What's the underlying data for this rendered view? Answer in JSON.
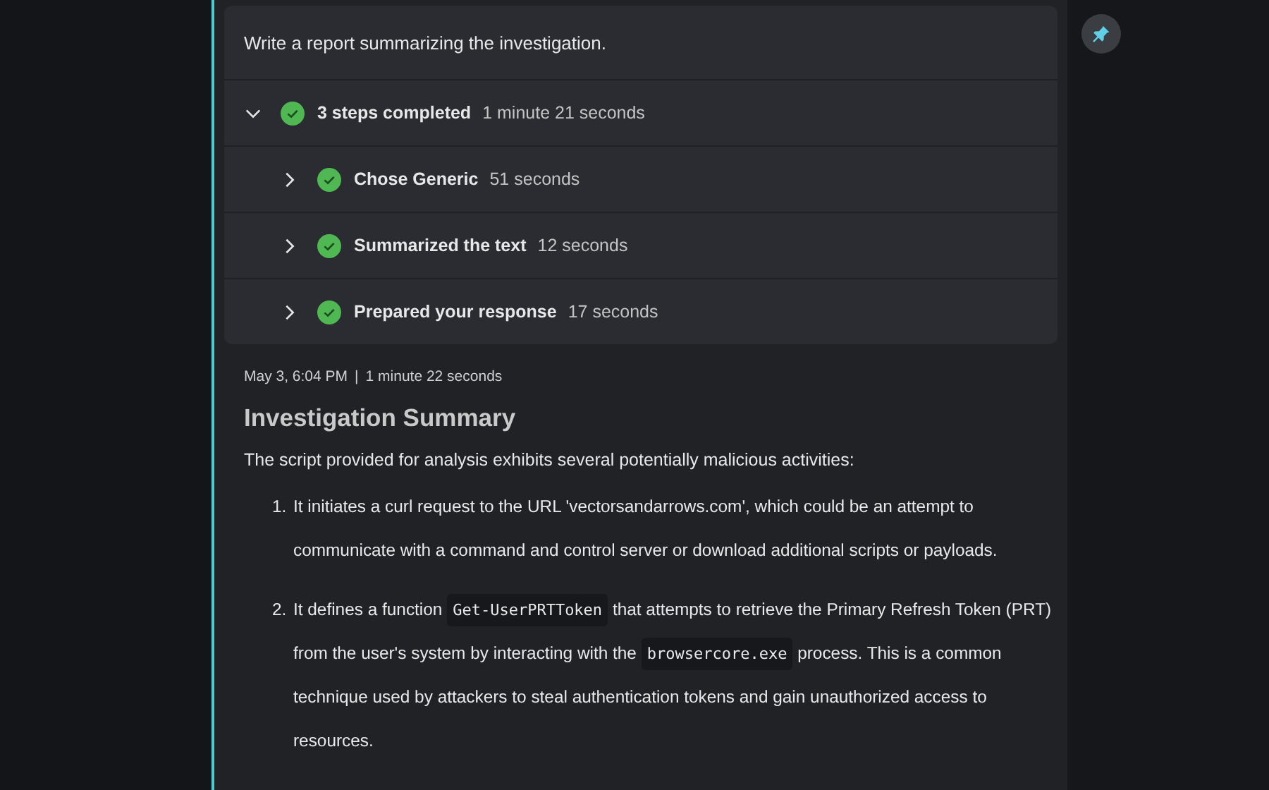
{
  "prompt": "Write a report summarizing the investigation.",
  "steps": {
    "label": "3 steps completed",
    "duration": "1 minute 21 seconds",
    "expanded": true,
    "completed": true,
    "children": [
      {
        "label": "Chose Generic",
        "duration": "51 seconds",
        "expanded": false,
        "completed": true
      },
      {
        "label": "Summarized the text",
        "duration": "12 seconds",
        "expanded": false,
        "completed": true
      },
      {
        "label": "Prepared your response",
        "duration": "17 seconds",
        "expanded": false,
        "completed": true
      }
    ]
  },
  "meta": {
    "timestamp": "May 3, 6:04 PM",
    "separator": "|",
    "duration": "1 minute 22 seconds"
  },
  "response": {
    "heading": "Investigation Summary",
    "intro": "The script provided for analysis exhibits several potentially malicious activities:",
    "items": [
      {
        "number": "1.",
        "parts": [
          {
            "kind": "text",
            "text": "It initiates a curl request to the URL 'vectorsandarrows.com', which could be an attempt to communicate with a command and control server or download additional scripts or payloads."
          }
        ]
      },
      {
        "number": "2.",
        "parts": [
          {
            "kind": "text",
            "text": "It defines a function "
          },
          {
            "kind": "code",
            "text": "Get-UserPRTToken"
          },
          {
            "kind": "text",
            "text": " that attempts to retrieve the Primary Refresh Token (PRT) from the user's system by interacting with the "
          },
          {
            "kind": "code",
            "text": "browsercore.exe"
          },
          {
            "kind": "text",
            "text": " process. This is a common technique used by attackers to steal authentication tokens and gain unauthorized access to resources."
          }
        ]
      }
    ]
  }
}
